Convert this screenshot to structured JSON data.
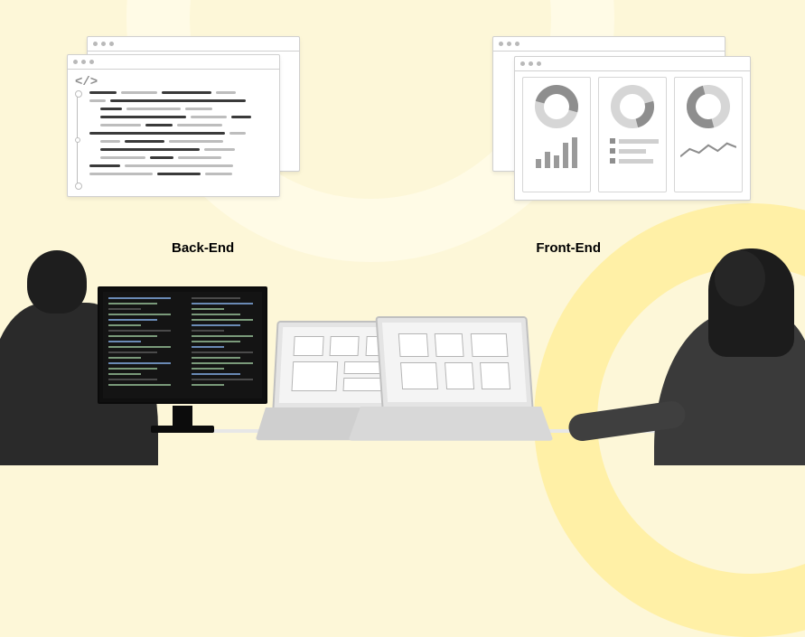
{
  "labels": {
    "backend": "Back-End",
    "frontend": "Front-End"
  }
}
